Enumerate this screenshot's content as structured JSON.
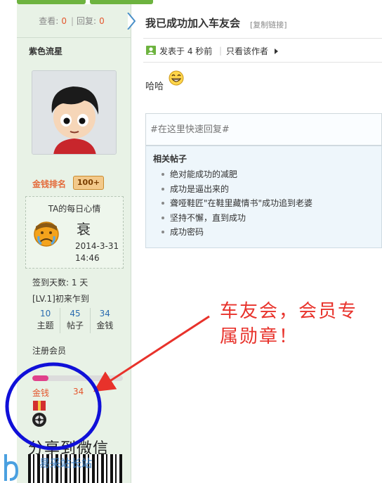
{
  "stats_bar": {
    "views_label": "查看:",
    "views_value": "0",
    "replies_label": "回复:",
    "replies_value": "0"
  },
  "user": {
    "name": "紫色流星",
    "rank_label": "金钱排名",
    "rank_badge": "100+",
    "mood": {
      "title": "TA的每日心情",
      "word": "衰",
      "date": "2014-3-31",
      "time": "14:46"
    },
    "sign_days": "签到天数: 1 天",
    "level": "[LV.1]初来乍到",
    "counts": [
      {
        "value": "10",
        "label": "主题"
      },
      {
        "value": "45",
        "label": "帖子"
      },
      {
        "value": "34",
        "label": "金钱"
      }
    ],
    "group": "注册会员",
    "progress": 0.18,
    "money_label": "金钱",
    "money_value": "34"
  },
  "share": {
    "text": "分享到微信",
    "watermark": "易采站长站"
  },
  "post": {
    "title": "我已成功加入车友会",
    "copy_link": "[复制链接]",
    "posted": "发表于 4 秒前",
    "only_author": "只看该作者",
    "content": "哈哈"
  },
  "quick_reply": {
    "placeholder": "#在这里快速回复#"
  },
  "related": {
    "heading": "相关帖子",
    "items": [
      "绝对能成功的减肥",
      "成功是逼出来的",
      "聋哑鞋匠\"在鞋里藏情书\"成功追到老婆",
      "坚持不懈，直到成功",
      "成功密码"
    ]
  },
  "annotation": {
    "line1": "车友会，会员专",
    "line2": "属勋章！"
  },
  "colors": {
    "sidebar_bg": "#e8f2e6",
    "accent_red": "#e8322b",
    "circle_blue": "#1010d8",
    "link_blue": "#2b6cb0",
    "progress_pink": "#e0418b"
  }
}
